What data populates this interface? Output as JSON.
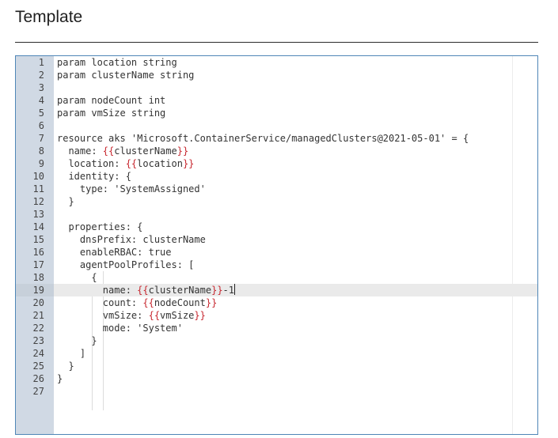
{
  "heading": "Template",
  "editor": {
    "active_line": 19,
    "lines": [
      {
        "n": "1",
        "segs": [
          {
            "t": "param location string"
          }
        ]
      },
      {
        "n": "2",
        "segs": [
          {
            "t": "param clusterName string"
          }
        ]
      },
      {
        "n": "3",
        "segs": []
      },
      {
        "n": "4",
        "segs": [
          {
            "t": "param nodeCount int"
          }
        ]
      },
      {
        "n": "5",
        "segs": [
          {
            "t": "param vmSize string"
          }
        ]
      },
      {
        "n": "6",
        "segs": []
      },
      {
        "n": "7",
        "segs": [
          {
            "t": "resource aks 'Microsoft.ContainerService/managedClusters@2021-05-01' = {"
          }
        ]
      },
      {
        "n": "8",
        "segs": [
          {
            "t": "  name: "
          },
          {
            "t": "{{",
            "ph": true
          },
          {
            "t": "clusterName"
          },
          {
            "t": "}}",
            "ph": true
          }
        ]
      },
      {
        "n": "9",
        "segs": [
          {
            "t": "  location: "
          },
          {
            "t": "{{",
            "ph": true
          },
          {
            "t": "location"
          },
          {
            "t": "}}",
            "ph": true
          }
        ]
      },
      {
        "n": "10",
        "segs": [
          {
            "t": "  identity: {"
          }
        ]
      },
      {
        "n": "11",
        "segs": [
          {
            "t": "    type: 'SystemAssigned'"
          }
        ]
      },
      {
        "n": "12",
        "segs": [
          {
            "t": "  }"
          }
        ]
      },
      {
        "n": "13",
        "segs": []
      },
      {
        "n": "14",
        "segs": [
          {
            "t": "  properties: {"
          }
        ]
      },
      {
        "n": "15",
        "segs": [
          {
            "t": "    dnsPrefix: clusterName"
          }
        ]
      },
      {
        "n": "16",
        "segs": [
          {
            "t": "    enableRBAC: true"
          }
        ]
      },
      {
        "n": "17",
        "segs": [
          {
            "t": "    agentPoolProfiles: ["
          }
        ]
      },
      {
        "n": "18",
        "segs": [
          {
            "t": "      {"
          }
        ]
      },
      {
        "n": "19",
        "segs": [
          {
            "t": "        name: "
          },
          {
            "t": "{{",
            "ph": true
          },
          {
            "t": "clusterName"
          },
          {
            "t": "}}",
            "ph": true
          },
          {
            "t": "-1"
          }
        ]
      },
      {
        "n": "20",
        "segs": [
          {
            "t": "        count: "
          },
          {
            "t": "{{",
            "ph": true
          },
          {
            "t": "nodeCount"
          },
          {
            "t": "}}",
            "ph": true
          }
        ]
      },
      {
        "n": "21",
        "segs": [
          {
            "t": "        vmSize: "
          },
          {
            "t": "{{",
            "ph": true
          },
          {
            "t": "vmSize"
          },
          {
            "t": "}}",
            "ph": true
          }
        ]
      },
      {
        "n": "22",
        "segs": [
          {
            "t": "        mode: 'System'"
          }
        ]
      },
      {
        "n": "23",
        "segs": [
          {
            "t": "      }"
          }
        ]
      },
      {
        "n": "24",
        "segs": [
          {
            "t": "    ]"
          }
        ]
      },
      {
        "n": "25",
        "segs": [
          {
            "t": "  }"
          }
        ]
      },
      {
        "n": "26",
        "segs": [
          {
            "t": "}"
          }
        ]
      },
      {
        "n": "27",
        "segs": []
      }
    ]
  }
}
